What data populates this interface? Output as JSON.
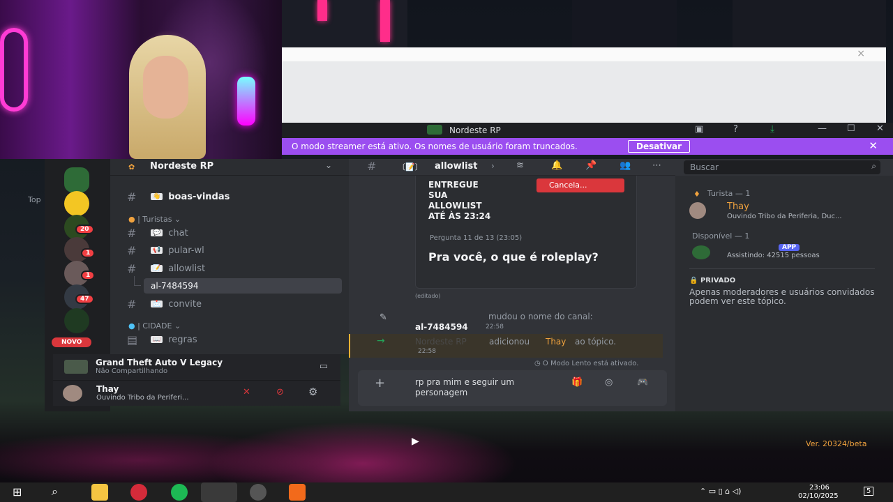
{
  "window": {
    "title": "Nordeste RP"
  },
  "banner": {
    "text": "O modo streamer está ativo. Os nomes de usuário foram truncados.",
    "button": "Desativar"
  },
  "server": {
    "name": "Nordeste RP"
  },
  "sidebar": {
    "top_label": "Top",
    "new_label": "NOVO",
    "badges": [
      "20",
      "1",
      "1",
      "47"
    ]
  },
  "channels": [
    {
      "type": "channel",
      "emoji": "👋",
      "name": "boas-vindas",
      "bold": true
    },
    {
      "type": "category",
      "name": "| Turistas"
    },
    {
      "type": "channel",
      "emoji": "💬",
      "name": "chat"
    },
    {
      "type": "channel",
      "emoji": "📢",
      "name": "pular-wl"
    },
    {
      "type": "channel",
      "emoji": "📝",
      "name": "allowlist"
    },
    {
      "type": "thread",
      "name": "al-7484594"
    },
    {
      "type": "channel",
      "emoji": "📩",
      "name": "convite"
    },
    {
      "type": "category",
      "name": "| CIDADE"
    },
    {
      "type": "channel",
      "emoji": "📖",
      "name": "regras"
    }
  ],
  "activity": {
    "game": "Grand Theft Auto V Legacy",
    "status": "Não Compartilhando"
  },
  "user": {
    "name": "Thay",
    "status": "Ouvindo Tribo da Periferi..."
  },
  "header": {
    "channel": "allowlist",
    "search_placeholder": "Buscar"
  },
  "messages": {
    "card_title_lines": [
      "ENTREGUE",
      "SUA",
      "ALLOWLIST",
      "ATÉ ÀS 23:24"
    ],
    "cancel_button": "Cancela...",
    "question_label": "Pergunta 11 de 13 (23:05)",
    "question": "Pra você, o que é roleplay?",
    "edited": "(editado)",
    "system1_text": "mudou o nome do canal:",
    "system1_name": "al-7484594",
    "system1_time": "22:58",
    "system2_prefix": "Nordeste RP",
    "system2_text": "adicionou",
    "system2_user": "Thay",
    "system2_suffix": "ao tópico.",
    "system2_time": "22:58",
    "slowmode": "O Modo Lento está ativado."
  },
  "composer": {
    "text": "rp pra mim e seguir um personagem"
  },
  "members": {
    "group1": "Turista — 1",
    "member1_name": "Thay",
    "member1_status": "Ouvindo Tribo da Periferia, Duc...",
    "group2": "Disponível — 1",
    "member2_tag": "APP",
    "member2_status": "Assistindo: 42515 pessoas",
    "private_title": "PRIVADO",
    "private_text": "Apenas moderadores e usuários convidados podem ver este tópico."
  },
  "footer": {
    "version": "Ver. 20324/beta"
  },
  "taskbar": {
    "time": "23:06",
    "date": "02/10/2025",
    "notif": "5"
  },
  "colors": {
    "accent": "#9b4ef0",
    "danger": "#da373c",
    "orange": "#f0a23e"
  }
}
